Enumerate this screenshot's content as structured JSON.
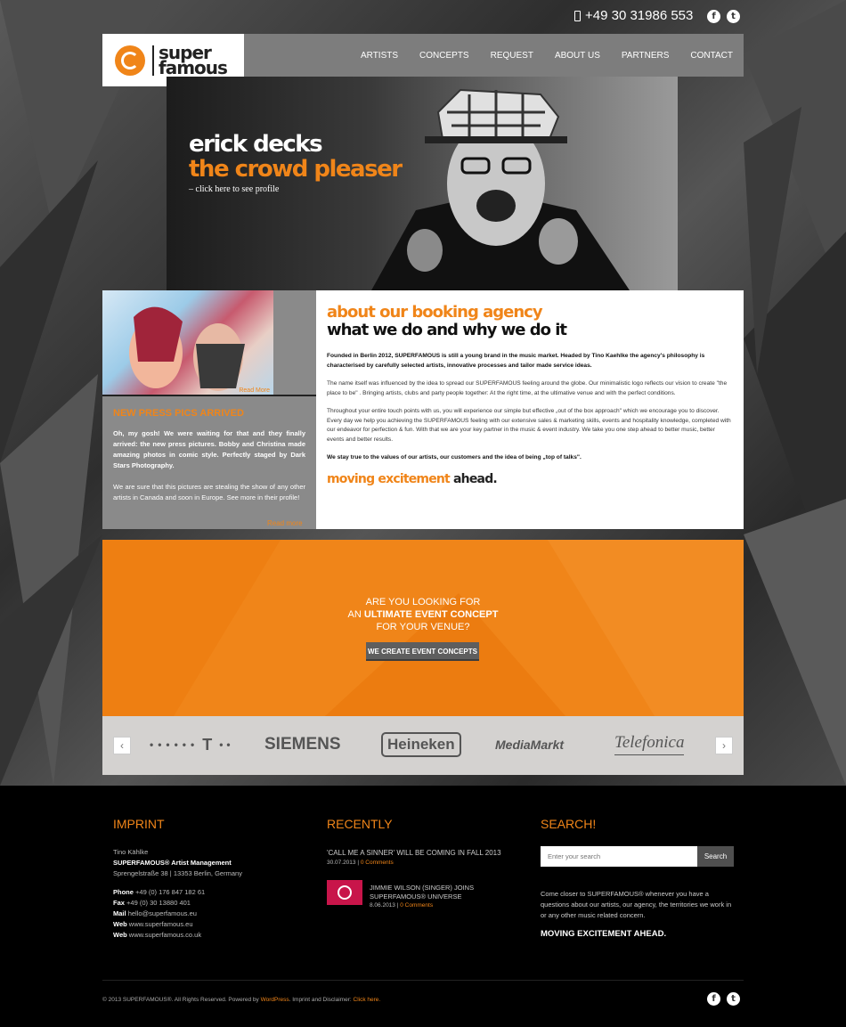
{
  "topbar": {
    "phone": "+49 30 31986 553",
    "icons": [
      "phone-icon",
      "facebook-icon",
      "twitter-icon"
    ]
  },
  "logo": {
    "text_line1": "super",
    "text_line2": "famous"
  },
  "nav": {
    "items": [
      {
        "label": "ARTISTS"
      },
      {
        "label": "CONCEPTS"
      },
      {
        "label": "REQUEST"
      },
      {
        "label": "ABOUT US"
      },
      {
        "label": "PARTNERS"
      },
      {
        "label": "CONTACT"
      }
    ]
  },
  "hero": {
    "line1": "erick decks",
    "line2": "the crowd pleaser",
    "link": "– click here to see profile"
  },
  "sidebar": {
    "image_caption": "Read More",
    "heading": "NEW PRESS PICS ARRIVED",
    "para1": "Oh, my gosh! We were waiting for that and they finally arrived: the new press pictures. Bobby and Christina made amazing photos in comic style. Perfectly staged by Dark Stars Photography.",
    "para2": "We are sure that this pictures are stealing the show of any other artists in Canada and soon in Europe. See more in their profile!",
    "read_more": "Read more"
  },
  "about": {
    "heading1": "about our booking agency",
    "heading2": "what we do and why we do it",
    "para1": "Founded in Berlin 2012, SUPERFAMOUS is still a young brand in the music market. Headed by Tino Kaehlke the agency's philosophy is characterised by carefully selected artists, innovative processes and tailor made service ideas.",
    "para2": "The name itself was influenced by the idea to spread our SUPERFAMOUS feeling around the globe. Our minimalistic logo reflects our vision to create \"the place to be\" . Bringing artists, clubs and party people together: At the right time, at the ultimative venue and with the perfect conditions.",
    "para3": "Throughout your entire touch points with us, you will experience our simple but effective „out of the box approach\" which we encourage you to discover. Every day we help you achieving the SUPERFAMOUS feeling with our extensive sales & marketing skills, events and hospitality knowledge, completed with our endeavor for perfection & fun. With that we are your key partner in the music & event industry. We take you one step ahead to better music, better events and better results.",
    "para4": "We stay true to the values of our artists, our customers and the idea of being „top of talks\".",
    "tagline_orange": "moving excitement",
    "tagline_dark": "ahead."
  },
  "cta": {
    "line1": "ARE YOU LOOKING FOR",
    "line2_pre": "AN ",
    "line2_bold": "ULTIMATE EVENT CONCEPT",
    "line3": "FOR YOUR VENUE?",
    "button": "WE CREATE EVENT CONCEPTS"
  },
  "partners": {
    "logos": [
      "T",
      "SIEMENS",
      "Heineken",
      "MediaMarkt",
      "Telefonica"
    ]
  },
  "footer": {
    "imprint": {
      "heading": "IMPRINT",
      "name": "Tino Kählke",
      "company": "SUPERFAMOUS® Artist Management",
      "address": "Sprengelstraße 38 | 13353 Berlin, Germany",
      "phone_label": "Phone",
      "phone": "+49 (0) 176 847 182 61",
      "fax_label": "Fax",
      "fax": "+49 (0) 30 13880 401",
      "mail_label": "Mail",
      "mail": "hello@superfamous.eu",
      "web_label": "Web",
      "web1": "www.superfamous.eu",
      "web2": "www.superfamous.co.uk"
    },
    "recently": {
      "heading": "RECENTLY",
      "post1_title": "'CALL ME A SINNER' WILL BE COMING IN FALL 2013",
      "post1_date": "30.07.2013 |",
      "post1_comments": "0 Comments",
      "post2_title": "JIMMIE WILSON (SINGER) JOINS SUPERFAMOUS® UNIVERSE",
      "post2_date": "8.06.2013 |",
      "post2_comments": "0 Comments"
    },
    "search": {
      "heading": "SEARCH!",
      "placeholder": "Enter your search",
      "button": "Search",
      "text": "Come closer to SUPERFAMOUS® whenever you have a questions about our artists, our agency, the territories we work in or any other music related concern.",
      "tagline": "MOVING EXCITEMENT AHEAD."
    },
    "copyright_pre": "© 2013 SUPERFAMOUS®. All Rights Reserved. Powered by",
    "wordpress": "WordPress",
    "imprint_disclaimer": ". Imprint and Disclaimer:",
    "click_here": "Click here."
  },
  "colors": {
    "accent": "#f08519",
    "dark": "#000000",
    "nav_bg": "#7d7d7d"
  }
}
